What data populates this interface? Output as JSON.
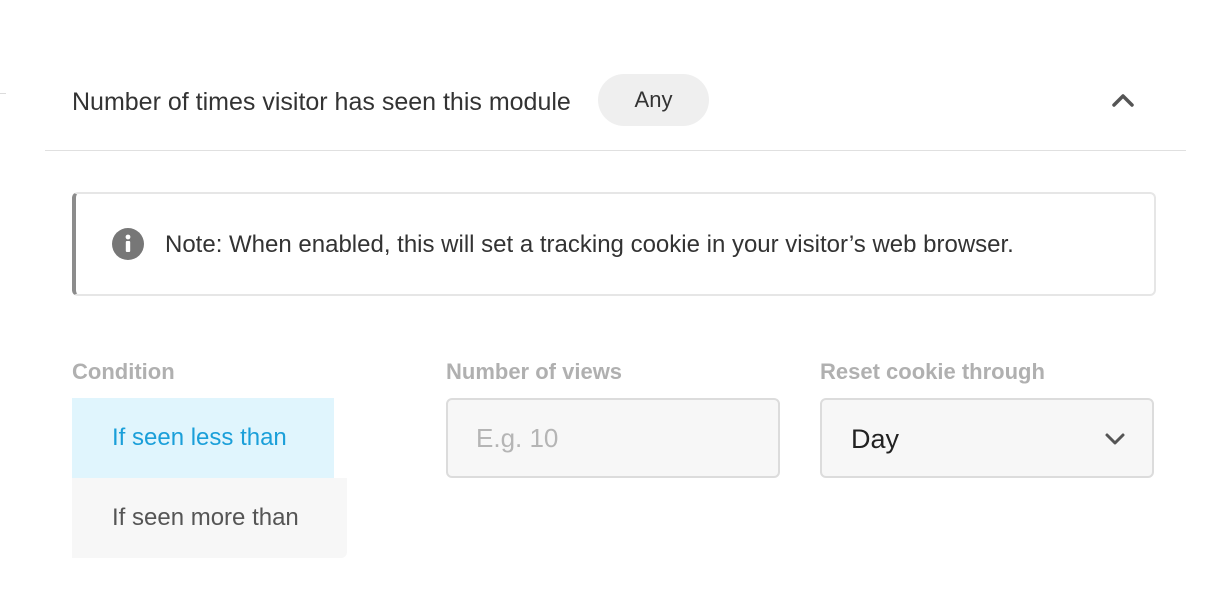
{
  "header": {
    "title": "Number of times visitor has seen this module",
    "badge": "Any",
    "collapse_icon": "chevron-up-icon"
  },
  "notice": {
    "icon": "info-icon",
    "text": "Note: When enabled, this will set a tracking cookie in your visitor’s web browser."
  },
  "condition": {
    "label": "Condition",
    "options": [
      "If seen less than",
      "If seen more than"
    ],
    "selected": "If seen less than",
    "accent_color": "#1a9fd9"
  },
  "views": {
    "label": "Number of views",
    "value": "",
    "placeholder": "E.g. 10"
  },
  "reset": {
    "label": "Reset cookie through",
    "selected": "Day",
    "icon": "chevron-down-icon"
  }
}
